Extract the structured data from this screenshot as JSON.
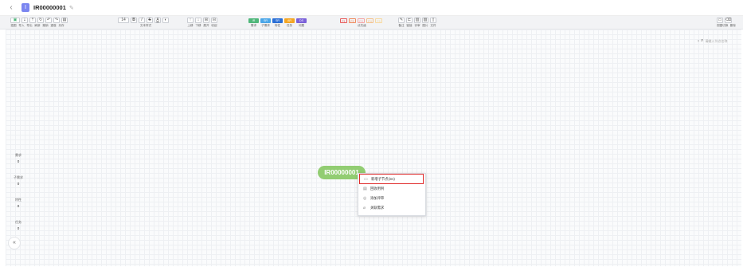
{
  "header": {
    "back_icon": "chevron-left",
    "doc_title": "IR00000001"
  },
  "toolbar": {
    "edit": {
      "labels": [
        "插图",
        "导入",
        "导出",
        "刷新",
        "撤销",
        "重做",
        "另存"
      ]
    },
    "font": {
      "size": "14",
      "label": "文本样式"
    },
    "node": {
      "labels": [
        "上移",
        "下移",
        "展开",
        "收起"
      ]
    },
    "tags": {
      "chips": [
        {
          "text": "IR",
          "color": "#4fb77a"
        },
        {
          "text": "SR",
          "color": "#4aa6e8"
        },
        {
          "text": "SR",
          "color": "#2b6fd6"
        },
        {
          "text": "AR",
          "color": "#f4a623"
        },
        {
          "text": "DS",
          "color": "#7b61d9"
        }
      ],
      "labels": [
        "需求",
        "子需求",
        "特性",
        "任务",
        "问题"
      ]
    },
    "marks": {
      "chips": [
        {
          "text": "P1",
          "color": "#e85a5a"
        },
        {
          "text": "P2",
          "color": "#f08a5d"
        },
        {
          "text": "P3",
          "color": "#f5a3a3"
        },
        {
          "text": "P4",
          "color": "#f4c08a"
        },
        {
          "text": "P5",
          "color": "#f7d9a0"
        }
      ],
      "label": "优先级"
    },
    "insert": {
      "labels": [
        "备注",
        "链接",
        "评审",
        "图片",
        "文件"
      ]
    },
    "right": {
      "labels": [
        "视图切换",
        "删除"
      ]
    }
  },
  "search": {
    "placeholder": "请输入节点名称"
  },
  "stats": [
    {
      "label": "需求",
      "value": "0"
    },
    {
      "label": "子需求",
      "value": "0"
    },
    {
      "label": "特性",
      "value": "0"
    },
    {
      "label": "任务",
      "value": "0"
    }
  ],
  "collapse_label": "«",
  "node": {
    "label": "IR00000001"
  },
  "context_menu": {
    "items": [
      {
        "icon": "▭",
        "label": "新增子节点(ins)",
        "highlight": true
      },
      {
        "icon": "▤",
        "label": "回收用例",
        "highlight": false
      },
      {
        "icon": "◎",
        "label": "添加评审",
        "highlight": false
      },
      {
        "icon": "⌀",
        "label": "关联需求",
        "highlight": false
      }
    ]
  }
}
